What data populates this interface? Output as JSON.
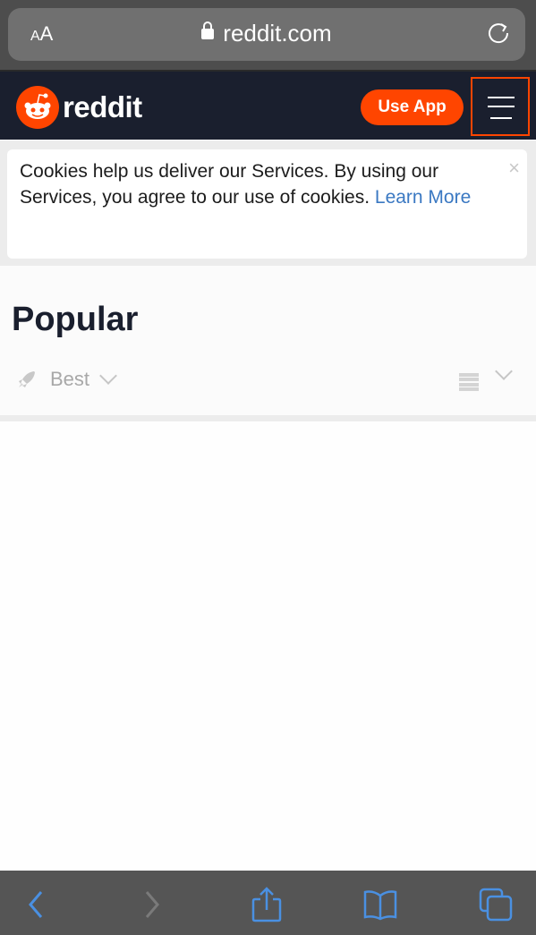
{
  "browser": {
    "text_size_label_small": "A",
    "text_size_label_large": "A",
    "url": "reddit.com",
    "icons": {
      "lock": "lock-icon",
      "reload": "reload-icon"
    }
  },
  "header": {
    "logo_text": "reddit",
    "use_app_label": "Use App",
    "menu_icon": "hamburger-menu-icon",
    "brand_color": "#ff4500",
    "background_color": "#1a1f2e"
  },
  "cookie_banner": {
    "message": "Cookies help us deliver our Services. By using our Services, you agree to our use of cookies.",
    "link_label": "Learn More",
    "close_label": "×"
  },
  "page": {
    "title": "Popular",
    "sort": {
      "icon": "rocket-icon",
      "selected": "Best"
    },
    "view_icon": "card-view-icon"
  },
  "toolbar": {
    "back": "back-icon",
    "forward": "forward-icon",
    "share": "share-icon",
    "bookmarks": "bookmarks-icon",
    "tabs": "tabs-icon",
    "accent_color": "#4a90e2"
  }
}
